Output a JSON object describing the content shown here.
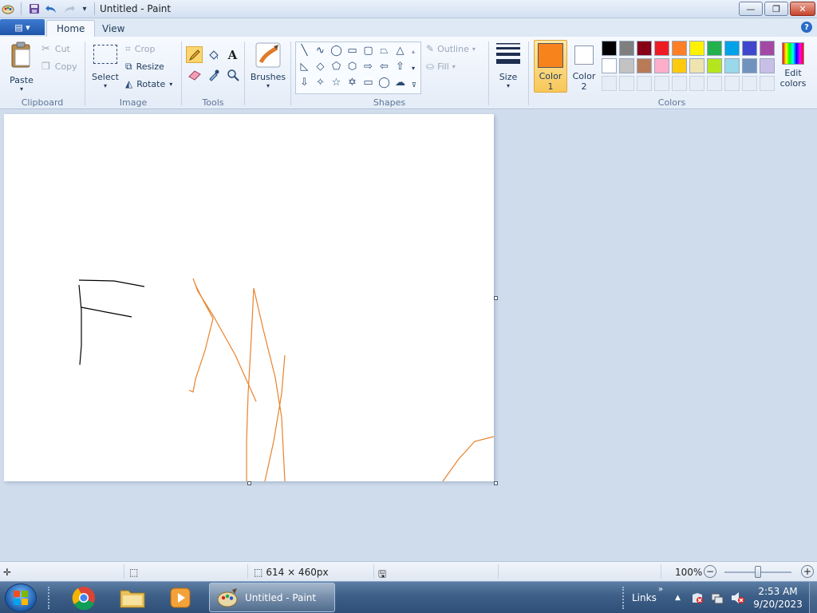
{
  "window": {
    "title": "Untitled - Paint",
    "controls": {
      "minimize": "—",
      "maximize": "❐",
      "close": "✕"
    }
  },
  "quick_access": {
    "customize_arrow": "▾"
  },
  "app_menu": {
    "glyph": "▤ ▾"
  },
  "tabs": [
    {
      "label": "Home",
      "active": true
    },
    {
      "label": "View",
      "active": false
    }
  ],
  "help": "?",
  "ribbon": {
    "clipboard": {
      "group_label": "Clipboard",
      "paste": "Paste",
      "cut": "Cut",
      "copy": "Copy"
    },
    "image": {
      "group_label": "Image",
      "select": "Select",
      "crop": "Crop",
      "resize": "Resize",
      "rotate": "Rotate"
    },
    "tools": {
      "group_label": "Tools",
      "text_tool_glyph": "A"
    },
    "brushes": {
      "label": "Brushes"
    },
    "shapes": {
      "group_label": "Shapes",
      "outline": "Outline",
      "fill": "Fill"
    },
    "size": {
      "label": "Size"
    },
    "color1": {
      "label_line1": "Color",
      "label_line2": "1",
      "value": "#f7831d"
    },
    "color2": {
      "label_line1": "Color",
      "label_line2": "2",
      "value": "#ffffff"
    },
    "colors": {
      "group_label": "Colors",
      "palette_row1": [
        "#000000",
        "#7f7f7f",
        "#880015",
        "#ed1c24",
        "#ff7f27",
        "#fff200",
        "#22b14c",
        "#00a2e8",
        "#3f48cc",
        "#a349a4"
      ],
      "palette_row2": [
        "#ffffff",
        "#c3c3c3",
        "#b97a57",
        "#ffaec9",
        "#ffc90e",
        "#efe4b0",
        "#b5e61d",
        "#99d9ea",
        "#7092be",
        "#c8bfe7"
      ],
      "edit_colors_line1": "Edit",
      "edit_colors_line2": "colors"
    }
  },
  "canvas": {
    "stroke_colors": {
      "black": "#000000",
      "orange": "#e8822b"
    }
  },
  "statusbar": {
    "canvas_size": "614 × 460px",
    "zoom": "100%",
    "zoom_level": 0.5
  },
  "taskbar": {
    "paint_label": "Untitled - Paint",
    "links": "Links",
    "time": "2:53 AM",
    "date": "9/20/2023"
  }
}
